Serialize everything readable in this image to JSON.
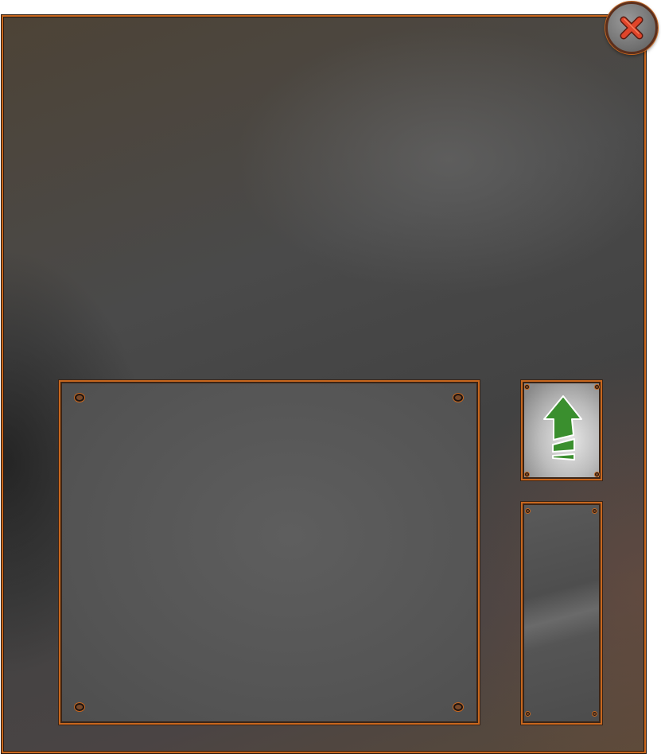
{
  "window": {
    "border_color": "#c8671e",
    "background": "dark steel"
  },
  "close_button": {
    "icon": "close-x-icon",
    "color": "#e0452a"
  },
  "upgrade_button": {
    "icon": "upgrade-arrow-icon",
    "color": "#3a8f2e"
  },
  "panels": {
    "main": "empty",
    "side": "empty"
  }
}
